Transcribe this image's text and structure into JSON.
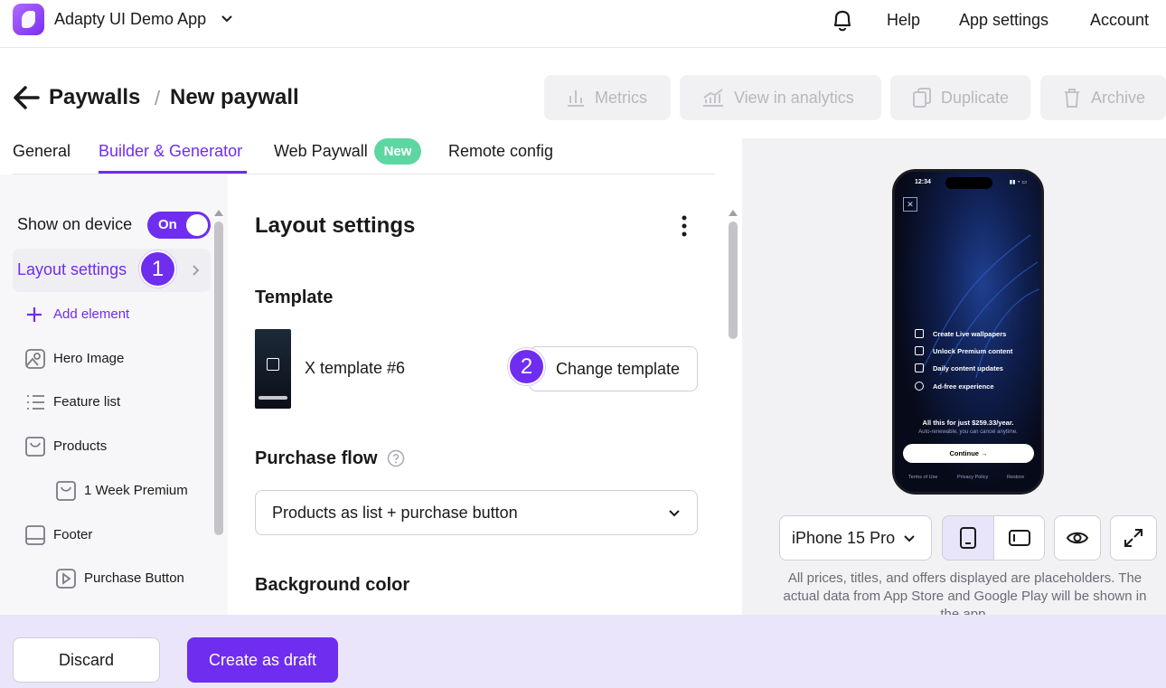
{
  "colors": {
    "accent": "#6f2df0",
    "badge_new": "#5ed6a2",
    "bottom_bar": "#ebe5fb"
  },
  "topbar": {
    "app_name": "Adapty UI Demo App",
    "links": [
      "Help",
      "App settings",
      "Account"
    ]
  },
  "breadcrumb": {
    "parent": "Paywalls",
    "separator": "/",
    "current": "New paywall"
  },
  "actions": {
    "metrics": "Metrics",
    "analytics": "View in analytics",
    "duplicate": "Duplicate",
    "archive": "Archive"
  },
  "tabs": [
    {
      "label": "General"
    },
    {
      "label": "Builder & Generator"
    },
    {
      "label": "Web Paywall",
      "badge": "New"
    },
    {
      "label": "Remote config"
    }
  ],
  "sidebar": {
    "show_on_device": "Show on device",
    "toggle": "On",
    "layout_settings": "Layout settings",
    "step_1": "1",
    "add_element": "Add element",
    "items": [
      "Hero Image",
      "Feature list",
      "Products",
      "1 Week Premium",
      "Footer",
      "Purchase Button"
    ]
  },
  "main": {
    "title": "Layout settings",
    "template_heading": "Template",
    "template_name": "X template #6",
    "step_2": "2",
    "change_template": "Change template",
    "purchase_flow_heading": "Purchase flow",
    "purchase_flow_value": "Products as list + purchase button",
    "background_heading": "Background color"
  },
  "preview": {
    "time": "12:34",
    "features": [
      "Create Live wallpapers",
      "Unlock Premium content",
      "Daily content updates",
      "Ad-free experience"
    ],
    "price": "All this for just $259.33/year.",
    "sub": "Auto-renewable, you can cancel anytime.",
    "cta": "Continue →",
    "links": [
      "Terms of Use",
      "Privacy Policy",
      "Restore"
    ],
    "device": "iPhone 15 Pro",
    "note": "All prices, titles, and offers displayed are placeholders. The actual data from App Store and Google Play will be shown in the app."
  },
  "footer": {
    "discard": "Discard",
    "create": "Create as draft"
  }
}
